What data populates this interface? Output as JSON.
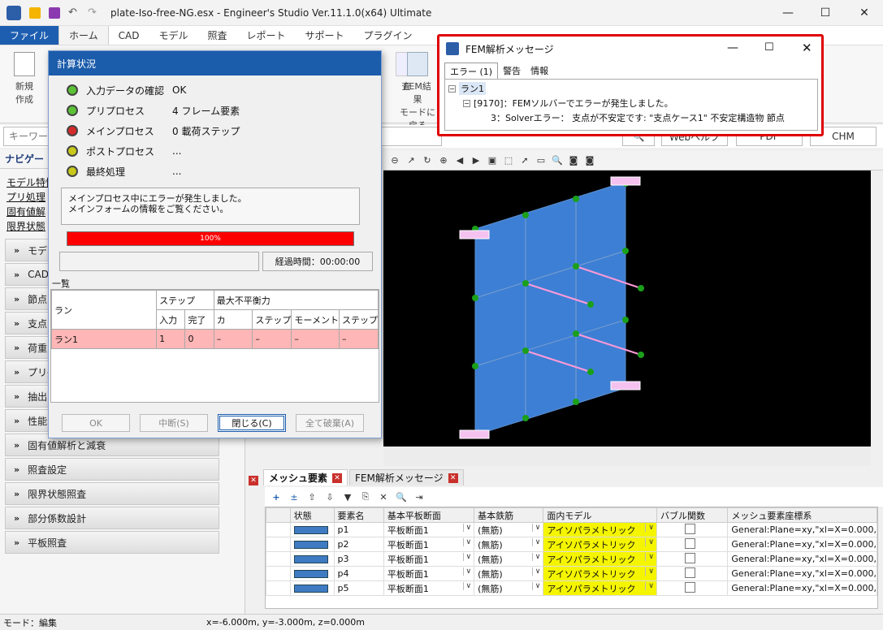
{
  "window": {
    "title": "plate-Iso-free-NG.esx - Engineer's Studio Ver.11.1.0(x64) Ultimate",
    "controls": [
      "—",
      "☐",
      "✕"
    ]
  },
  "menu": [
    "ファイル",
    "ホーム",
    "CAD",
    "モデル",
    "照査",
    "レポート",
    "サポート",
    "プラグイン"
  ],
  "ribbon": {
    "new_label": "新規\n作成",
    "fem_label": "FEM結果\nモードに戻る",
    "partial_label": "査"
  },
  "search": {
    "placeholder": "キーワード",
    "web_help": "Webヘルプ",
    "pdf": "PDF",
    "chm": "CHM"
  },
  "navigator": {
    "title": "ナビゲー",
    "links": [
      "モデル特性",
      "プリ処理",
      "固有値解",
      "限界状態"
    ],
    "sections": [
      "モデル",
      "CAD",
      "節点",
      "支点",
      "荷重",
      "プリ処",
      "抽出",
      "性能",
      "固有値解析と減衰",
      "照査設定",
      "限界状態照査",
      "部分係数設計",
      "平板照査"
    ]
  },
  "calc_dialog": {
    "title": "計算状況",
    "steps": [
      {
        "label": "入力データの確認",
        "value": "OK",
        "color": "#5bc236"
      },
      {
        "label": "プリプロセス",
        "value": "4 フレーム要素",
        "color": "#5bc236"
      },
      {
        "label": "メインプロセス",
        "value": "0 載荷ステップ",
        "color": "#d42a2a"
      },
      {
        "label": "ポストプロセス",
        "value": "...",
        "color": "#c8c81a"
      },
      {
        "label": "最終処理",
        "value": "...",
        "color": "#c8c81a"
      }
    ],
    "message": "メインプロセス中にエラーが発生しました。\nメインフォームの情報をご覧ください。",
    "progress": "100%",
    "elapsed": "経過時間：00:00:00",
    "list_title": "一覧",
    "table_headers": {
      "run": "ラン",
      "step": "ステップ",
      "max_unbalanced": "最大不平衡力",
      "input": "入力",
      "done": "完了",
      "force": "カ",
      "step2": "ステップ",
      "moment": "モーメント",
      "step3": "ステップ"
    },
    "rows": [
      {
        "run": "ラン1",
        "input": "1",
        "done": "0",
        "force": "–",
        "step": "–",
        "moment": "–",
        "step3": "–"
      }
    ],
    "buttons": {
      "ok": "OK",
      "interrupt": "中断(S)",
      "close": "閉じる(C)",
      "discard": "全て破棄(A)"
    }
  },
  "fem_dialog": {
    "title": "FEM解析メッセージ",
    "tabs": [
      "エラー (1)",
      "警告",
      "情報"
    ],
    "tree": [
      "ラン1",
      "[9170]：FEMソルバーでエラーが発生しました。",
      "3：Solverエラー： 支点が不安定です: \"支点ケース1\" 不安定構造物 節点"
    ]
  },
  "bottom_tabs": [
    "メッシュ要素",
    "FEM解析メッセージ"
  ],
  "mesh_table": {
    "headers": [
      "状態",
      "要素名",
      "基本平板断面",
      "基本鉄筋",
      "面内モデル",
      "バブル関数",
      "メッシュ要素座標系"
    ],
    "rows": [
      {
        "name": "p1",
        "section": "平板断面1",
        "rebar": "(無筋)",
        "model": "アイソパラメトリック",
        "coord": "General:Plane=xy,\"xl=X=0.000,"
      },
      {
        "name": "p2",
        "section": "平板断面1",
        "rebar": "(無筋)",
        "model": "アイソパラメトリック",
        "coord": "General:Plane=xy,\"xl=X=0.000,"
      },
      {
        "name": "p3",
        "section": "平板断面1",
        "rebar": "(無筋)",
        "model": "アイソパラメトリック",
        "coord": "General:Plane=xy,\"xl=X=0.000,"
      },
      {
        "name": "p4",
        "section": "平板断面1",
        "rebar": "(無筋)",
        "model": "アイソパラメトリック",
        "coord": "General:Plane=xy,\"xl=X=0.000,"
      },
      {
        "name": "p5",
        "section": "平板断面1",
        "rebar": "(無筋)",
        "model": "アイソパラメトリック",
        "coord": "General:Plane=xy,\"xl=X=0.000,"
      }
    ]
  },
  "status": {
    "mode": "モード：編集",
    "coords": "x=-6.000m, y=-3.000m, z=0.000m"
  },
  "colors": {
    "accent": "#1b5cab",
    "highlight_red": "#e00000",
    "yellow": "#f5f500",
    "error_row": "#ffb6b6"
  }
}
